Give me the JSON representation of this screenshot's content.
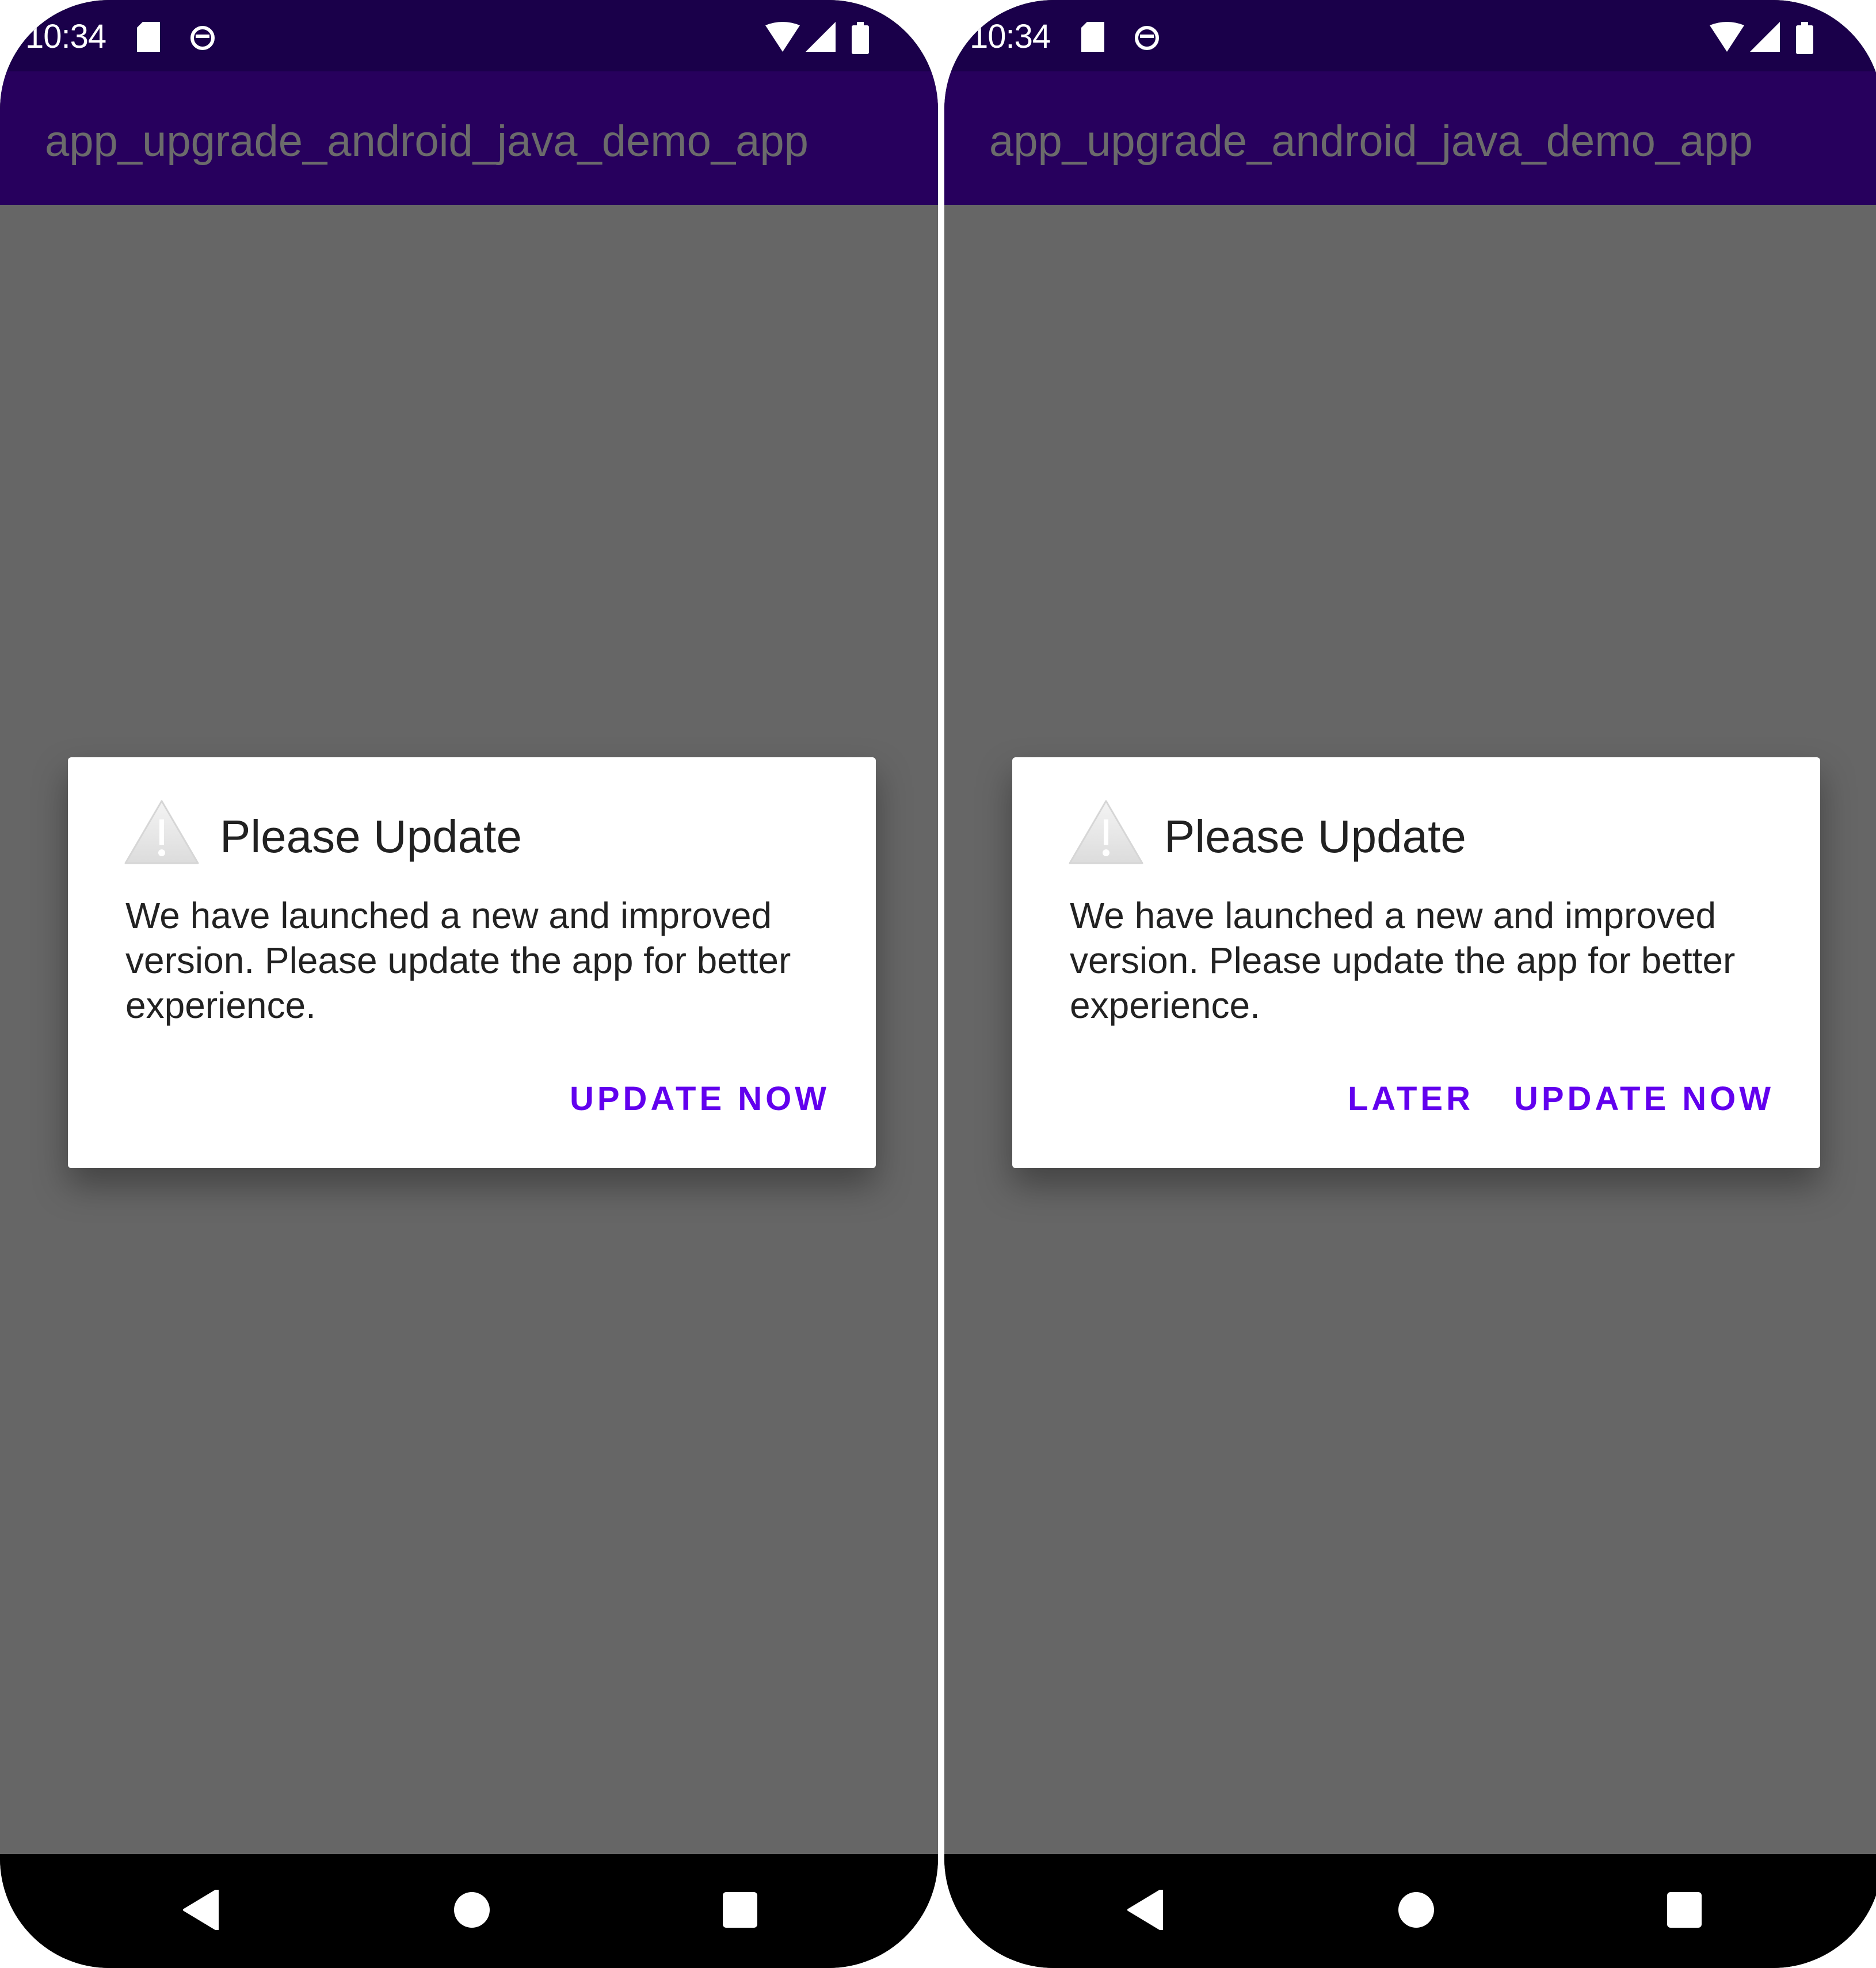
{
  "screens": [
    {
      "status_bar": {
        "time": "10:34",
        "icons": [
          "sd-card-icon",
          "sync-icon",
          "wifi-icon",
          "signal-icon",
          "battery-icon"
        ]
      },
      "app_bar": {
        "title": "app_upgrade_android_java_demo_app"
      },
      "dialog": {
        "icon": "warning-icon",
        "title": "Please Update",
        "message": "We have launched a new and improved version. Please update the app for better experience.",
        "buttons": [
          "UPDATE NOW"
        ]
      },
      "nav_bar": {
        "buttons": [
          "back",
          "home",
          "recents"
        ]
      }
    },
    {
      "status_bar": {
        "time": "10:34",
        "icons": [
          "sd-card-icon",
          "sync-icon",
          "wifi-icon",
          "signal-icon",
          "battery-icon"
        ]
      },
      "app_bar": {
        "title": "app_upgrade_android_java_demo_app"
      },
      "dialog": {
        "icon": "warning-icon",
        "title": "Please Update",
        "message": "We have launched a new and improved version. Please update the app for better experience.",
        "buttons": [
          "LATER",
          "UPDATE NOW"
        ]
      },
      "nav_bar": {
        "buttons": [
          "back",
          "home",
          "recents"
        ]
      }
    }
  ],
  "colors": {
    "status_bar": "#1a004a",
    "app_bar": "#27005d",
    "scrim": "#666666",
    "accent": "#6200ee"
  }
}
